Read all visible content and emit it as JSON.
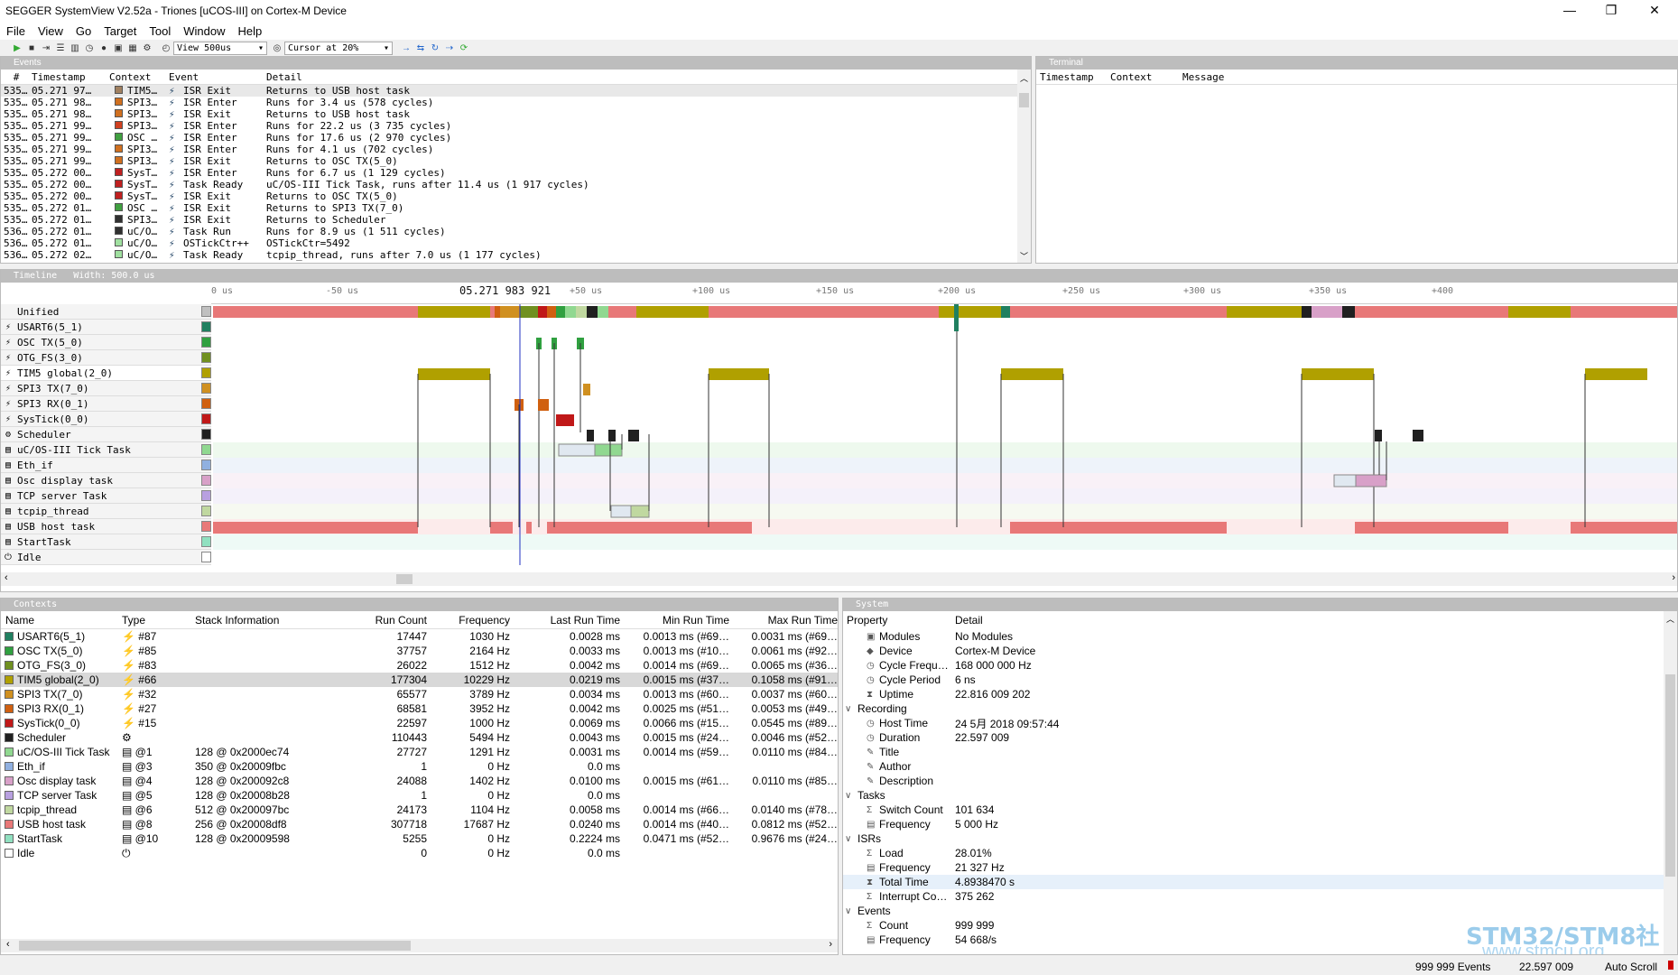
{
  "window": {
    "title": "SEGGER SystemView V2.52a - Triones [uCOS-III] on Cortex-M Device",
    "minimize": "—",
    "maximize": "❐",
    "close": "✕"
  },
  "menu": [
    "File",
    "View",
    "Go",
    "Target",
    "Tool",
    "Window",
    "Help"
  ],
  "toolbar": {
    "view_combo": "View 500us",
    "cursor_combo": "Cursor at 20%"
  },
  "events": {
    "title": "Events",
    "headers": [
      "#",
      "Timestamp",
      "Context",
      "Event",
      "Detail"
    ],
    "rows": [
      {
        "n": "535…",
        "ts": "05.271 97…",
        "ctx": "TIM5…",
        "color": "#a08060",
        "ev": "ISR Exit",
        "detail": "Returns to USB host task"
      },
      {
        "n": "535…",
        "ts": "05.271 98…",
        "ctx": "SPI3…",
        "color": "#d07020",
        "ev": "ISR Enter",
        "detail": "Runs for 3.4 us (578 cycles)"
      },
      {
        "n": "535…",
        "ts": "05.271 98…",
        "ctx": "SPI3…",
        "color": "#d07020",
        "ev": "ISR Exit",
        "detail": "Returns to USB host task"
      },
      {
        "n": "535…",
        "ts": "05.271 99…",
        "ctx": "SPI3…",
        "color": "#d04020",
        "ev": "ISR Enter",
        "detail": "Runs for 22.2 us (3 735 cycles)"
      },
      {
        "n": "535…",
        "ts": "05.271 99…",
        "ctx": "OSC …",
        "color": "#40a040",
        "ev": "ISR Enter",
        "detail": "Runs for 17.6 us (2 970 cycles)"
      },
      {
        "n": "535…",
        "ts": "05.271 99…",
        "ctx": "SPI3…",
        "color": "#d07020",
        "ev": "ISR Enter",
        "detail": "Runs for 4.1 us (702 cycles)"
      },
      {
        "n": "535…",
        "ts": "05.271 99…",
        "ctx": "SPI3…",
        "color": "#d07020",
        "ev": "ISR Exit",
        "detail": "Returns to OSC TX(5_0)"
      },
      {
        "n": "535…",
        "ts": "05.272 00…",
        "ctx": "SysT…",
        "color": "#c02020",
        "ev": "ISR Enter",
        "detail": "Runs for 6.7 us (1 129 cycles)"
      },
      {
        "n": "535…",
        "ts": "05.272 00…",
        "ctx": "SysT…",
        "color": "#c02020",
        "ev": "Task Ready",
        "detail": "uC/OS-III Tick Task, runs after 11.4 us (1 917 cycles)"
      },
      {
        "n": "535…",
        "ts": "05.272 00…",
        "ctx": "SysT…",
        "color": "#c02020",
        "ev": "ISR Exit",
        "detail": "Returns to OSC TX(5_0)"
      },
      {
        "n": "535…",
        "ts": "05.272 01…",
        "ctx": "OSC …",
        "color": "#40a040",
        "ev": "ISR Exit",
        "detail": "Returns to SPI3 TX(7_0)"
      },
      {
        "n": "535…",
        "ts": "05.272 01…",
        "ctx": "SPI3…",
        "color": "#303030",
        "ev": "ISR Exit",
        "detail": "Returns to Scheduler"
      },
      {
        "n": "536…",
        "ts": "05.272 01…",
        "ctx": "uC/O…",
        "color": "#303030",
        "ev": "Task Run",
        "detail": "Runs for 8.9 us (1 511 cycles)"
      },
      {
        "n": "536…",
        "ts": "05.272 01…",
        "ctx": "uC/O…",
        "color": "#a0e0a0",
        "ev": "OSTickCtr++",
        "detail": "OSTickCtr=5492"
      },
      {
        "n": "536…",
        "ts": "05.272 02…",
        "ctx": "uC/O…",
        "color": "#a0e0a0",
        "ev": "Task Ready",
        "detail": "tcpip_thread, runs after 7.0 us (1 177 cycles)"
      }
    ]
  },
  "terminal": {
    "title": "Terminal",
    "headers": [
      "Timestamp",
      "Context",
      "Message"
    ]
  },
  "timeline": {
    "title": "Timeline",
    "width_label": "Width: 500.0 us",
    "cursor_label": "05.271 983 921",
    "ticks": [
      "0 us",
      "-50 us",
      "+50 us",
      "+100 us",
      "+150 us",
      "+200 us",
      "+250 us",
      "+300 us",
      "+350 us",
      "+400"
    ],
    "rows": [
      {
        "label": "Unified",
        "color": "#c0c0c0",
        "icon": ""
      },
      {
        "label": "USART6(5_1)",
        "color": "#208060",
        "icon": "⚡"
      },
      {
        "label": "OSC TX(5_0)",
        "color": "#30a040",
        "icon": "⚡"
      },
      {
        "label": "OTG_FS(3_0)",
        "color": "#709020",
        "icon": "⚡"
      },
      {
        "label": "TIM5 global(2_0)",
        "color": "#b0a000",
        "icon": "⚡"
      },
      {
        "label": "SPI3 TX(7_0)",
        "color": "#d09020",
        "icon": "⚡"
      },
      {
        "label": "SPI3 RX(0_1)",
        "color": "#d06010",
        "icon": "⚡"
      },
      {
        "label": "SysTick(0_0)",
        "color": "#c01818",
        "icon": "⚡"
      },
      {
        "label": "Scheduler",
        "color": "#202020",
        "icon": "⚙"
      },
      {
        "label": "uC/OS-III Tick Task",
        "color": "#90d890",
        "icon": "▤"
      },
      {
        "label": "Eth_if",
        "color": "#90b0e0",
        "icon": "▤"
      },
      {
        "label": "Osc display task",
        "color": "#d8a0c8",
        "icon": "▤"
      },
      {
        "label": "TCP server Task",
        "color": "#b8a0e0",
        "icon": "▤"
      },
      {
        "label": "tcpip_thread",
        "color": "#c0d8a0",
        "icon": "▤"
      },
      {
        "label": "USB host task",
        "color": "#e87878",
        "icon": "▤"
      },
      {
        "label": "StartTask",
        "color": "#90e0c0",
        "icon": "▤"
      },
      {
        "label": "Idle",
        "color": "#ffffff",
        "icon": "⏻"
      }
    ]
  },
  "contexts": {
    "title": "Contexts",
    "headers": [
      "Name",
      "Type",
      "Stack Information",
      "Run Count",
      "Frequency",
      "Last Run Time",
      "Min Run Time",
      "Max Run Time"
    ],
    "rows": [
      {
        "name": "USART6(5_1)",
        "color": "#208060",
        "type": "⚡ #87",
        "stack": "",
        "count": "17447",
        "freq": "1030 Hz",
        "last": "0.0028 ms",
        "min": "0.0013 ms (#69…",
        "max": "0.0031 ms (#69…"
      },
      {
        "name": "OSC TX(5_0)",
        "color": "#30a040",
        "type": "⚡ #85",
        "stack": "",
        "count": "37757",
        "freq": "2164 Hz",
        "last": "0.0033 ms",
        "min": "0.0013 ms (#10…",
        "max": "0.0061 ms (#92…"
      },
      {
        "name": "OTG_FS(3_0)",
        "color": "#709020",
        "type": "⚡ #83",
        "stack": "",
        "count": "26022",
        "freq": "1512 Hz",
        "last": "0.0042 ms",
        "min": "0.0014 ms (#69…",
        "max": "0.0065 ms (#36…"
      },
      {
        "name": "TIM5 global(2_0)",
        "color": "#b0a000",
        "type": "⚡ #66",
        "stack": "",
        "count": "177304",
        "freq": "10229 Hz",
        "last": "0.0219 ms",
        "min": "0.0015 ms (#37…",
        "max": "0.1058 ms (#91…"
      },
      {
        "name": "SPI3 TX(7_0)",
        "color": "#d09020",
        "type": "⚡ #32",
        "stack": "",
        "count": "65577",
        "freq": "3789 Hz",
        "last": "0.0034 ms",
        "min": "0.0013 ms (#60…",
        "max": "0.0037 ms (#60…"
      },
      {
        "name": "SPI3 RX(0_1)",
        "color": "#d06010",
        "type": "⚡ #27",
        "stack": "",
        "count": "68581",
        "freq": "3952 Hz",
        "last": "0.0042 ms",
        "min": "0.0025 ms (#51…",
        "max": "0.0053 ms (#49…"
      },
      {
        "name": "SysTick(0_0)",
        "color": "#c01818",
        "type": "⚡ #15",
        "stack": "",
        "count": "22597",
        "freq": "1000 Hz",
        "last": "0.0069 ms",
        "min": "0.0066 ms (#15…",
        "max": "0.0545 ms (#89…"
      },
      {
        "name": "Scheduler",
        "color": "#202020",
        "type": "⚙",
        "stack": "",
        "count": "110443",
        "freq": "5494 Hz",
        "last": "0.0043 ms",
        "min": "0.0015 ms (#24…",
        "max": "0.0046 ms (#52…"
      },
      {
        "name": "uC/OS-III Tick Task",
        "color": "#90d890",
        "type": "▤ @1",
        "stack": "128 @ 0x2000ec74",
        "count": "27727",
        "freq": "1291 Hz",
        "last": "0.0031 ms",
        "min": "0.0014 ms (#59…",
        "max": "0.0110 ms (#84…"
      },
      {
        "name": "Eth_if",
        "color": "#90b0e0",
        "type": "▤ @3",
        "stack": "350 @ 0x20009fbc",
        "count": "1",
        "freq": "0 Hz",
        "last": "0.0 ms",
        "min": "",
        "max": ""
      },
      {
        "name": "Osc display task",
        "color": "#d8a0c8",
        "type": "▤ @4",
        "stack": "128 @ 0x200092c8",
        "count": "24088",
        "freq": "1402 Hz",
        "last": "0.0100 ms",
        "min": "0.0015 ms (#61…",
        "max": "0.0110 ms (#85…"
      },
      {
        "name": "TCP server Task",
        "color": "#b8a0e0",
        "type": "▤ @5",
        "stack": "128 @ 0x20008b28",
        "count": "1",
        "freq": "0 Hz",
        "last": "0.0 ms",
        "min": "",
        "max": ""
      },
      {
        "name": "tcpip_thread",
        "color": "#c0d8a0",
        "type": "▤ @6",
        "stack": "512 @ 0x200097bc",
        "count": "24173",
        "freq": "1104 Hz",
        "last": "0.0058 ms",
        "min": "0.0014 ms (#66…",
        "max": "0.0140 ms (#78…"
      },
      {
        "name": "USB host task",
        "color": "#e87878",
        "type": "▤ @8",
        "stack": "256 @ 0x20008df8",
        "count": "307718",
        "freq": "17687 Hz",
        "last": "0.0240 ms",
        "min": "0.0014 ms (#40…",
        "max": "0.0812 ms (#52…"
      },
      {
        "name": "StartTask",
        "color": "#90e0c0",
        "type": "▤ @10",
        "stack": "128 @ 0x20009598",
        "count": "5255",
        "freq": "0 Hz",
        "last": "0.2224 ms",
        "min": "0.0471 ms (#52…",
        "max": "0.9676 ms (#24…"
      },
      {
        "name": "Idle",
        "color": "#ffffff",
        "type": "⏻",
        "stack": "",
        "count": "0",
        "freq": "0 Hz",
        "last": "0.0 ms",
        "min": "",
        "max": ""
      }
    ]
  },
  "system": {
    "title": "System",
    "headers": [
      "Property",
      "Detail"
    ],
    "rows": [
      {
        "group": false,
        "indent": 1,
        "icon": "▣",
        "prop": "Modules",
        "val": "No Modules"
      },
      {
        "group": false,
        "indent": 1,
        "icon": "◆",
        "prop": "Device",
        "val": "Cortex-M Device"
      },
      {
        "group": false,
        "indent": 1,
        "icon": "◷",
        "prop": "Cycle Frequ…",
        "val": "168 000 000 Hz"
      },
      {
        "group": false,
        "indent": 1,
        "icon": "◷",
        "prop": "Cycle Period",
        "val": "6 ns"
      },
      {
        "group": false,
        "indent": 1,
        "icon": "⧗",
        "prop": "Uptime",
        "val": "22.816 009 202"
      },
      {
        "group": true,
        "indent": 0,
        "icon": "∨",
        "prop": "Recording",
        "val": ""
      },
      {
        "group": false,
        "indent": 1,
        "icon": "◷",
        "prop": "Host Time",
        "val": "24 5月 2018 09:57:44"
      },
      {
        "group": false,
        "indent": 1,
        "icon": "◷",
        "prop": "Duration",
        "val": "22.597 009"
      },
      {
        "group": false,
        "indent": 1,
        "icon": "✎",
        "prop": "Title",
        "val": ""
      },
      {
        "group": false,
        "indent": 1,
        "icon": "✎",
        "prop": "Author",
        "val": ""
      },
      {
        "group": false,
        "indent": 1,
        "icon": "✎",
        "prop": "Description",
        "val": ""
      },
      {
        "group": true,
        "indent": 0,
        "icon": "∨",
        "prop": "Tasks",
        "val": ""
      },
      {
        "group": false,
        "indent": 1,
        "icon": "Σ",
        "prop": "Switch Count",
        "val": "101 634"
      },
      {
        "group": false,
        "indent": 1,
        "icon": "▤",
        "prop": "Frequency",
        "val": "5 000 Hz"
      },
      {
        "group": true,
        "indent": 0,
        "icon": "∨",
        "prop": "ISRs",
        "val": ""
      },
      {
        "group": false,
        "indent": 1,
        "icon": "Σ",
        "prop": "Load",
        "val": "28.01%"
      },
      {
        "group": false,
        "indent": 1,
        "icon": "▤",
        "prop": "Frequency",
        "val": "21 327 Hz"
      },
      {
        "group": false,
        "indent": 1,
        "icon": "⧗",
        "prop": "Total Time",
        "val": "4.8938470 s",
        "sel": true
      },
      {
        "group": false,
        "indent": 1,
        "icon": "Σ",
        "prop": "Interrupt Co…",
        "val": "375 262"
      },
      {
        "group": true,
        "indent": 0,
        "icon": "∨",
        "prop": "Events",
        "val": ""
      },
      {
        "group": false,
        "indent": 1,
        "icon": "Σ",
        "prop": "Count",
        "val": "999 999"
      },
      {
        "group": false,
        "indent": 1,
        "icon": "▤",
        "prop": "Frequency",
        "val": "54 668/s"
      }
    ]
  },
  "watermark": {
    "line1": "STM32/STM8社区",
    "line2": "www.stmcu.org"
  },
  "status": {
    "events": "999 999 Events",
    "time": "22.597 009",
    "autoscroll": "Auto Scroll"
  }
}
